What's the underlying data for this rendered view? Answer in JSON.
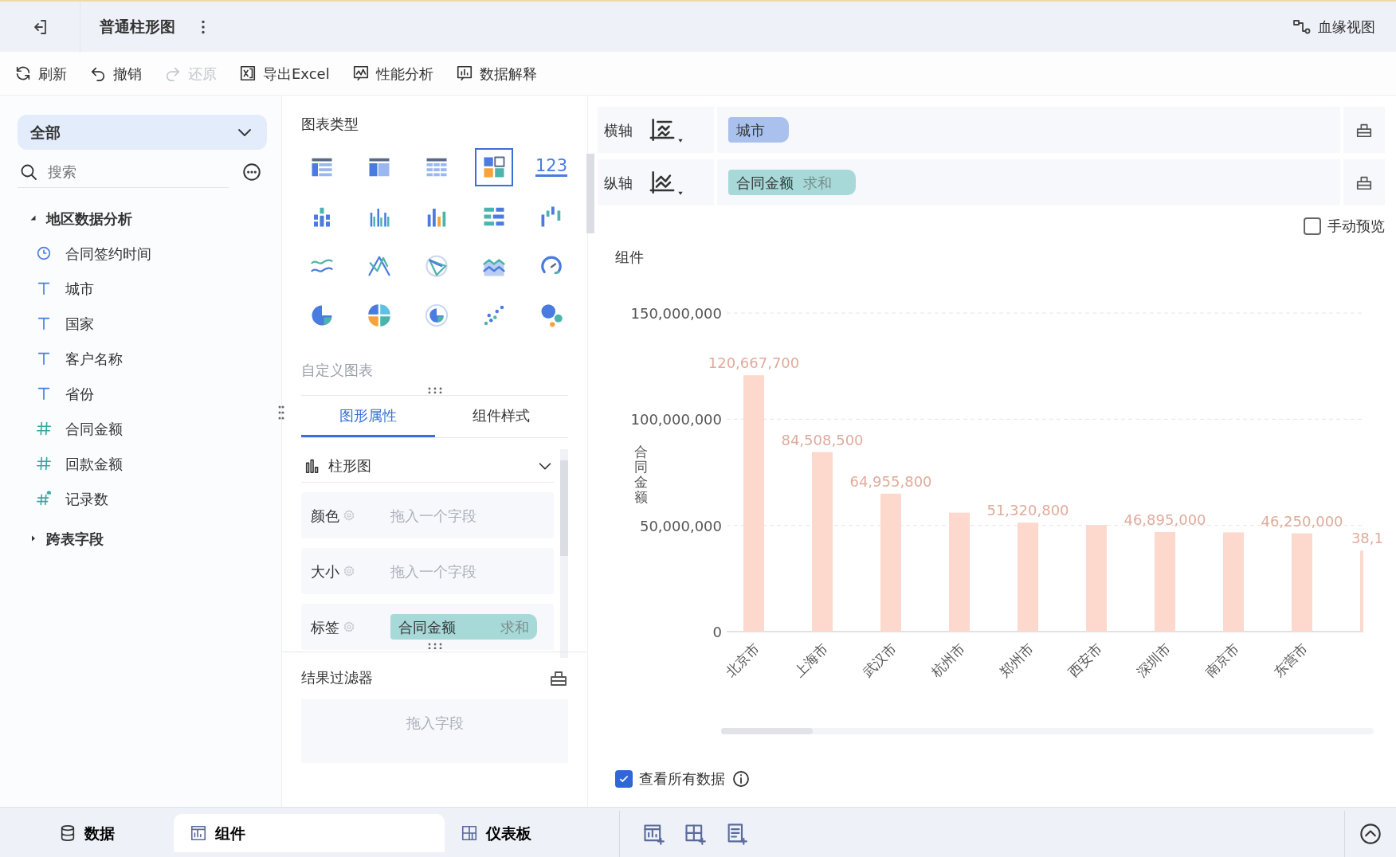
{
  "header": {
    "title": "普通柱形图",
    "lineage": "血缘视图"
  },
  "toolbar": [
    {
      "label": "刷新",
      "disabled": false
    },
    {
      "label": "撤销",
      "disabled": false
    },
    {
      "label": "还原",
      "disabled": true
    },
    {
      "label": "导出Excel",
      "disabled": false
    },
    {
      "label": "性能分析",
      "disabled": false
    },
    {
      "label": "数据解释",
      "disabled": false
    }
  ],
  "sidebar": {
    "dropdown": "全部",
    "search": {
      "placeholder": "搜索"
    },
    "tree": [
      {
        "label": "地区数据分析",
        "expanded": true,
        "children": [
          {
            "label": "合同签约时间",
            "kind": "date"
          },
          {
            "label": "城市",
            "kind": "text"
          },
          {
            "label": "国家",
            "kind": "text"
          },
          {
            "label": "客户名称",
            "kind": "text"
          },
          {
            "label": "省份",
            "kind": "text"
          },
          {
            "label": "合同金额",
            "kind": "number"
          },
          {
            "label": "回款金额",
            "kind": "number"
          },
          {
            "label": "记录数",
            "kind": "count"
          }
        ]
      },
      {
        "label": "跨表字段",
        "expanded": false
      }
    ]
  },
  "chart_types": {
    "title": "图表类型",
    "items": [
      {
        "selected": false
      },
      {
        "selected": false
      },
      {
        "selected": false
      },
      {
        "selected": true
      },
      {
        "selected": false,
        "label": "123"
      },
      {
        "selected": false
      },
      {
        "selected": false
      },
      {
        "selected": false
      },
      {
        "selected": false
      },
      {
        "selected": false
      },
      {
        "selected": false
      },
      {
        "selected": false
      },
      {
        "selected": false
      },
      {
        "selected": false
      },
      {
        "selected": false
      },
      {
        "selected": false
      },
      {
        "selected": false
      },
      {
        "selected": false
      },
      {
        "selected": false
      },
      {
        "selected": false
      }
    ],
    "custom": "自定义图表"
  },
  "property_tabs": [
    {
      "label": "图形属性",
      "selected": true
    },
    {
      "label": "组件样式",
      "selected": false
    }
  ],
  "chart_type_select": "柱形图",
  "properties": [
    {
      "label": "颜色",
      "placeholder": "拖入一个字段"
    },
    {
      "label": "大小",
      "placeholder": "拖入一个字段"
    },
    {
      "label": "标签",
      "field": "合同金额",
      "aggregate": "求和"
    }
  ],
  "result_filter": {
    "title": "结果过滤器",
    "placeholder": "拖入字段"
  },
  "axes": [
    {
      "label": "横轴",
      "field": "城市"
    },
    {
      "label": "纵轴",
      "field": "合同金额",
      "aggregate": "求和"
    }
  ],
  "manual_preview": {
    "label": "手动预览",
    "checked": false
  },
  "component_title": "组件",
  "chart_data": {
    "type": "bar",
    "ylabel": "合同金额",
    "categories": [
      "北京市",
      "上海市",
      "武汉市",
      "杭州市",
      "郑州市",
      "西安市",
      "深圳市",
      "南京市",
      "东营市",
      null
    ],
    "series": [
      {
        "color": "#fdd8cc",
        "values": [
          120667700,
          84508500,
          64955800,
          56000000,
          51320800,
          50200000,
          46895000,
          46700000,
          46250000,
          38100000
        ]
      }
    ],
    "value_labels": [
      "120,667,700",
      "84,508,500",
      "64,955,800",
      null,
      "51,320,800",
      null,
      "46,895,000",
      null,
      "46,250,000",
      "38,1"
    ],
    "ylim": [
      0,
      150000000
    ],
    "yticks": [
      {
        "value": 0,
        "label": "0"
      },
      {
        "value": 50000000,
        "label": "50,000,000"
      },
      {
        "value": 100000000,
        "label": "100,000,000"
      },
      {
        "value": 150000000,
        "label": "150,000,000"
      }
    ]
  },
  "view_all": {
    "label": "查看所有数据",
    "checked": true
  },
  "bottom_tabs": [
    {
      "label": "数据",
      "selected": false
    },
    {
      "label": "组件",
      "selected": true
    },
    {
      "label": "仪表板",
      "selected": false
    }
  ]
}
